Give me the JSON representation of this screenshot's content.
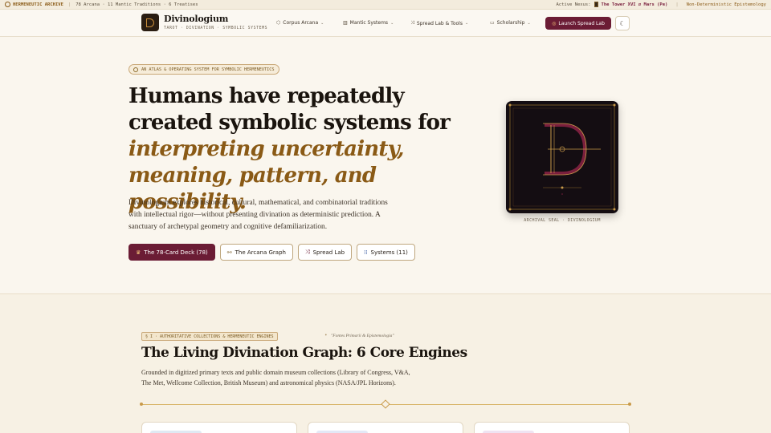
{
  "topbar": {
    "archive": "HERMENEUTIC ARCHIVE",
    "stats": "78 Arcana · 11 Mantic Traditions · 6 Treatises",
    "nexus_label": "Active Nexus:",
    "nexus_value": "The Tower XVI ⇄ Mars (Pe)",
    "epistemology": "Non-Deterministic Epistemology"
  },
  "nav": {
    "brand": "Divinologium",
    "subtitle": "TAROT · DIVINATION · SYMBOLIC SYSTEMS",
    "items": [
      {
        "label": "Corpus Arcana",
        "icon": "cube-icon"
      },
      {
        "label": "Mantic Systems",
        "icon": "bars-icon"
      },
      {
        "label": "Spread Lab & Tools",
        "icon": "shuffle-icon"
      },
      {
        "label": "Scholarship",
        "icon": "book-icon"
      }
    ],
    "launch_label": "Launch Spread Lab",
    "theme_icon": "moon-icon"
  },
  "hero": {
    "badge": "AN ATLAS & OPERATING SYSTEM FOR SYMBOLIC HERMENEUTICS",
    "title_plain": "Humans have repeatedly created symbolic systems for",
    "title_emph": "interpreting uncertainty, meaning, pattern, and possibility.",
    "lead": "Divinologium explores historical, cultural, mathematical, and combinatorial traditions with intellectual rigor—without presenting divination as deterministic prediction. A sanctuary of archetypal geometry and cognitive defamiliarization.",
    "buttons": [
      {
        "label": "The 78-Card Deck (78)",
        "icon": "crown-icon"
      },
      {
        "label": "The Arcana Graph",
        "icon": "graph-icon"
      },
      {
        "label": "Spread Lab",
        "icon": "shuffle-icon"
      },
      {
        "label": "Systems (11)",
        "icon": "grid-icon"
      }
    ],
    "seal_caption": "ARCHIVAL SEAL · DIVINOLOGIUM"
  },
  "section": {
    "badge": "§ I · AUTHORITATIVE COLLECTIONS & HERMENEUTIC ENGINES",
    "latin": "\"Fontes Primarii & Epistemologia\"",
    "title": "The Living Divination Graph: 6 Core Engines",
    "text": "Grounded in digitized primary texts and public domain museum collections (Library of Congress, V&A, The Met, Wellcome Collection, British Museum) and astronomical physics (NASA/JPL Horizons)."
  },
  "colors": {
    "accent": "#6b1c35",
    "gold": "#8a5a16",
    "background": "#faf6ee"
  }
}
